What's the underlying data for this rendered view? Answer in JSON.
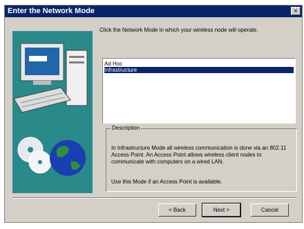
{
  "window": {
    "title": "Enter the Network Mode",
    "close_glyph": "×"
  },
  "instruction": "Click the Network Mode in which your wireless node will operate.",
  "network_modes": {
    "items": [
      "Ad Hoc",
      "Infrastructure"
    ],
    "selected": "Infrastructure"
  },
  "description": {
    "label": "Description",
    "text": "In Infrastructure Mode all wireless communication is done via an 802.11 Access Point. An Access Point allows wireless client nodes to communicate with computers on a wired LAN.",
    "note": "Use this Mode if an Access Point is available."
  },
  "buttons": {
    "back": "< Back",
    "next": "Next >",
    "cancel": "Cancel"
  },
  "colors": {
    "titlebar": "#0a246a",
    "art_background": "#2a8a8a",
    "selection": "#0a246a"
  },
  "icons": [
    "computer-icon",
    "cd-icon",
    "globe-icon"
  ]
}
